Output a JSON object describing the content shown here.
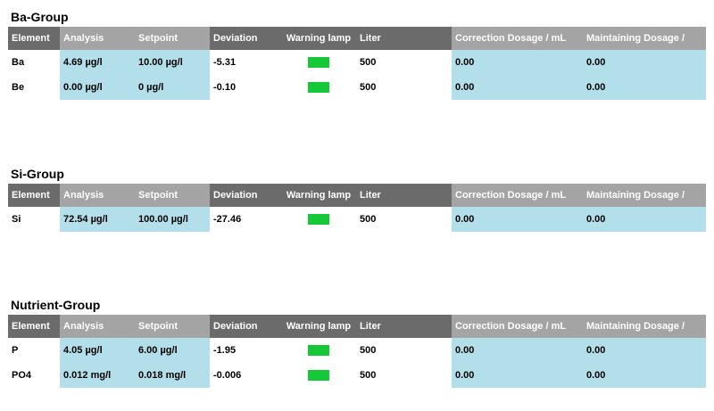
{
  "headers": [
    "Element",
    "Analysis",
    "Setpoint",
    "Deviation",
    "Warning lamp",
    "Liter",
    "Correction Dosage / mL",
    "Maintaining Dosage /"
  ],
  "lamp_color": "#14c837",
  "groups": [
    {
      "title": "Ba-Group",
      "rows": [
        {
          "element": "Ba",
          "analysis": "4.69 µg/l",
          "setpoint": "10.00 µg/l",
          "deviation": "-5.31",
          "liter": "500",
          "correction": "0.00",
          "maintaining": "0.00"
        },
        {
          "element": "Be",
          "analysis": "0.00 µg/l",
          "setpoint": "0 µg/l",
          "deviation": "-0.10",
          "liter": "500",
          "correction": "0.00",
          "maintaining": "0.00"
        }
      ]
    },
    {
      "title": "Si-Group",
      "rows": [
        {
          "element": "Si",
          "analysis": "72.54 µg/l",
          "setpoint": "100.00 µg/l",
          "deviation": "-27.46",
          "liter": "500",
          "correction": "0.00",
          "maintaining": "0.00"
        }
      ]
    },
    {
      "title": "Nutrient-Group",
      "rows": [
        {
          "element": "P",
          "analysis": "4.05 µg/l",
          "setpoint": "6.00 µg/l",
          "deviation": "-1.95",
          "liter": "500",
          "correction": "0.00",
          "maintaining": "0.00"
        },
        {
          "element": "PO4",
          "analysis": "0.012 mg/l",
          "setpoint": "0.018 mg/l",
          "deviation": "-0.006",
          "liter": "500",
          "correction": "0.00",
          "maintaining": "0.00"
        }
      ]
    }
  ]
}
